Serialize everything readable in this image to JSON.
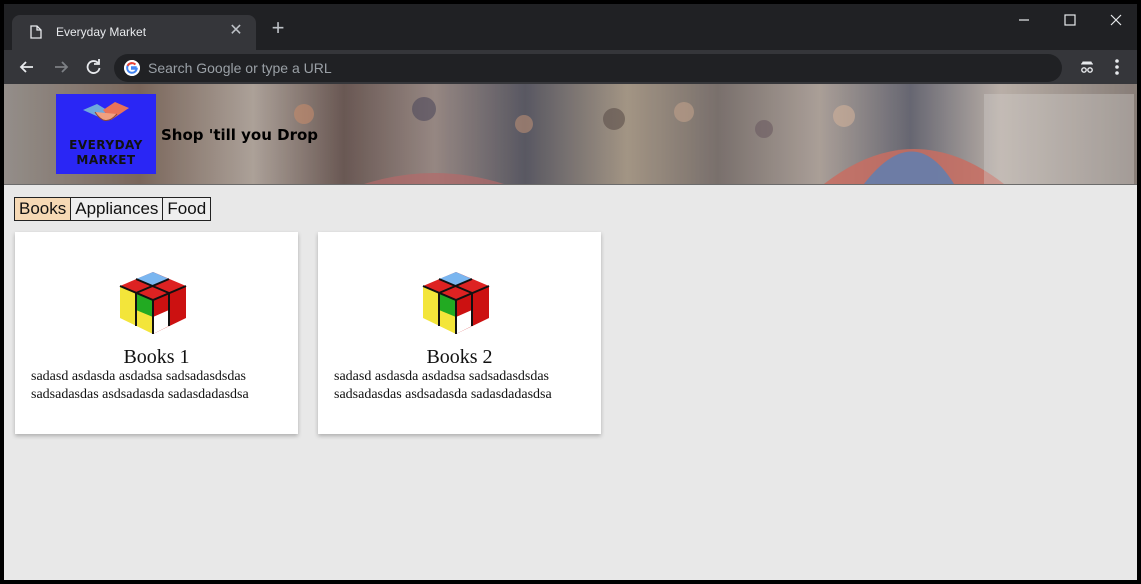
{
  "browser": {
    "tab_title": "Everyday Market",
    "tab_close": "✕",
    "new_tab": "+",
    "omnibox_placeholder": "Search Google or type a URL"
  },
  "site": {
    "logo_line1": "EVERYDAY",
    "logo_line2": "MARKET",
    "tagline": "Shop 'till you Drop"
  },
  "categories": [
    {
      "label": "Books",
      "active": true
    },
    {
      "label": "Appliances",
      "active": false
    },
    {
      "label": "Food",
      "active": false
    }
  ],
  "products": [
    {
      "title": "Books 1",
      "desc_line1": "sadasd asdasda asdadsa sadsadasdsdas",
      "desc_line2": "sadsadasdas asdsadasda sadasdadasdsa",
      "icon": "rubiks-cube-icon"
    },
    {
      "title": "Books 2",
      "desc_line1": "sadasd asdasda asdadsa sadsadasdsdas",
      "desc_line2": "sadsadasdas asdsadasda sadasdadasdsa",
      "icon": "rubiks-cube-icon"
    }
  ],
  "colors": {
    "chrome_dark": "#202124",
    "chrome_toolbar": "#35363a",
    "logo_bg": "#2a26f5",
    "active_tab": "#f6d9b5",
    "page_bg": "#e8e8e8"
  }
}
